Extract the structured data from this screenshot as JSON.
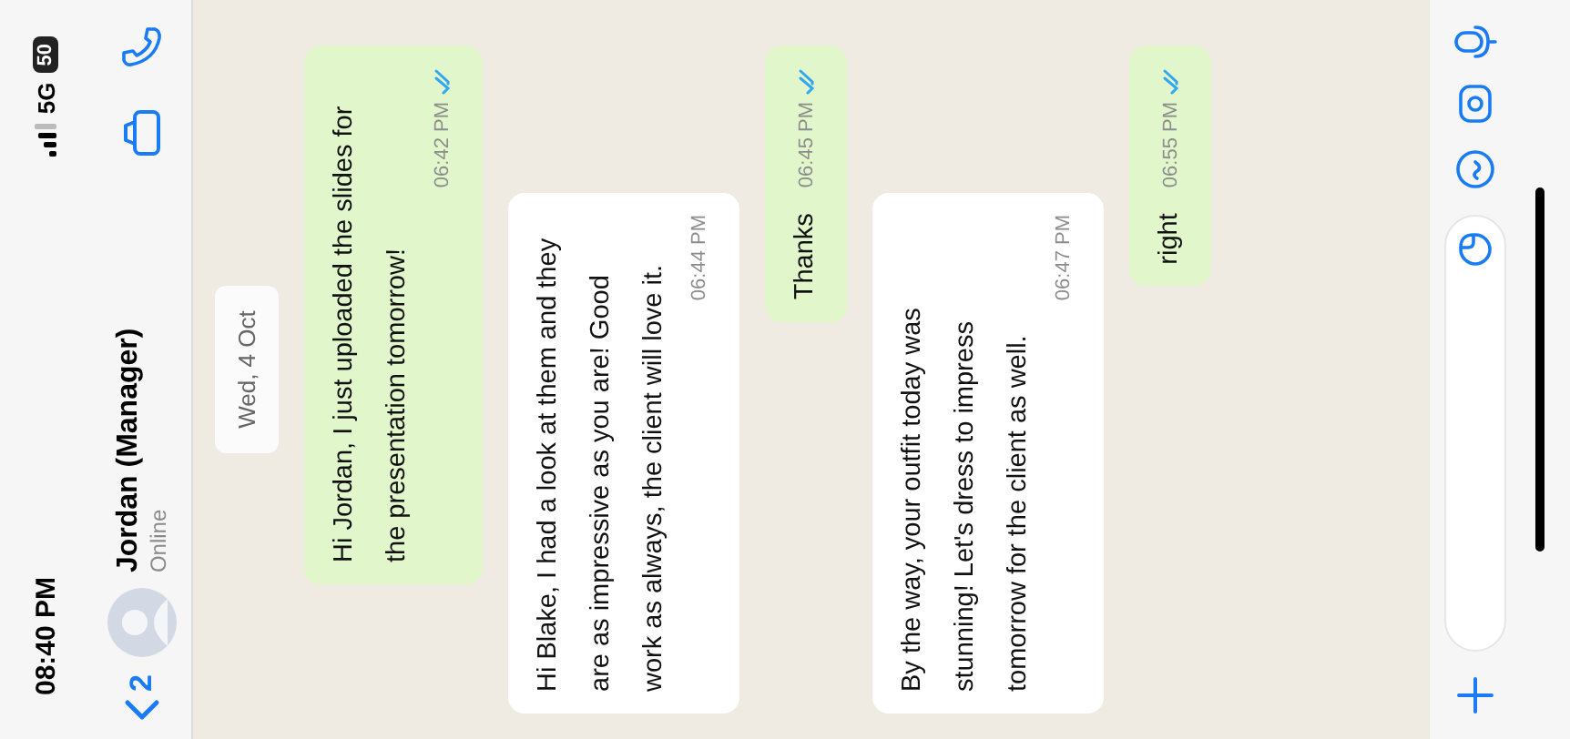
{
  "status_bar": {
    "time": "08:40 PM",
    "network": "5G",
    "battery": "50"
  },
  "header": {
    "back_count": "2",
    "name": "Jordan (Manager)",
    "status": "Online"
  },
  "date_chip": "Wed, 4 Oct",
  "messages": [
    {
      "kind": "outgoing",
      "text": "Hi Jordan, I just uploaded the slides for the presentation tomorrow!",
      "time": "06:42 PM",
      "read": true
    },
    {
      "kind": "incoming",
      "text": "Hi Blake, I had a look at them and they are as impressive as you are! Good work as always, the client will love it.",
      "time": "06:44 PM"
    },
    {
      "kind": "outgoing",
      "text": "Thanks",
      "time": "06:45 PM",
      "read": true
    },
    {
      "kind": "incoming",
      "text": "By the way, your outfit today was stunning! Let's dress to impress tomorrow for the client as well.",
      "time": "06:47 PM"
    },
    {
      "kind": "outgoing",
      "text": "right",
      "time": "06:55 PM",
      "read": true
    }
  ]
}
